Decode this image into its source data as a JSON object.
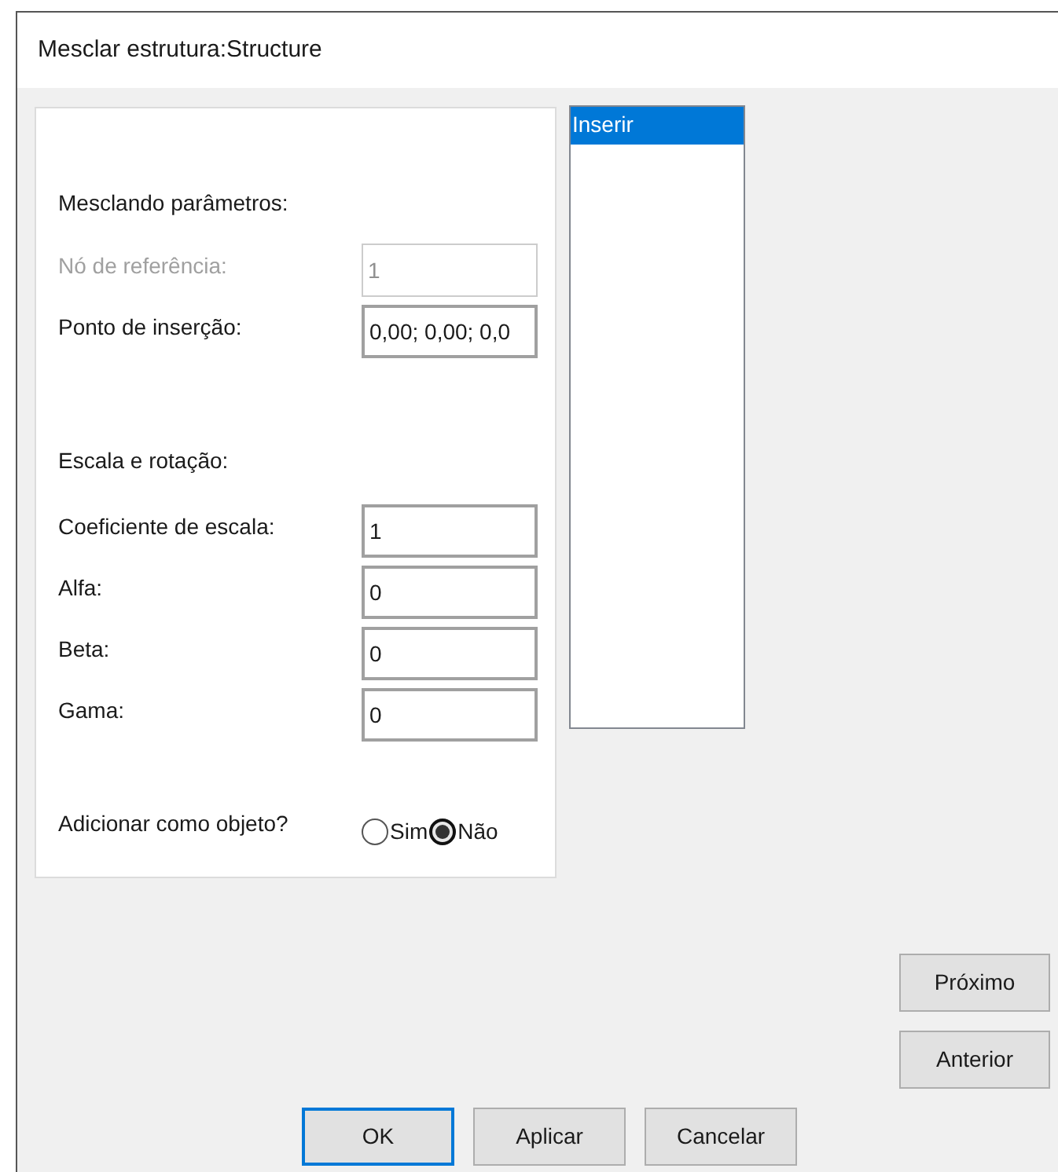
{
  "window": {
    "title": "Mesclar estrutura:Structure"
  },
  "sections": [
    {
      "heading": "Mesclando parâmetros:",
      "fields": [
        {
          "label": "Nó de referência:",
          "value": "1",
          "disabled": true
        },
        {
          "label": "Ponto de inserção:",
          "value": "0,00; 0,00; 0,0",
          "disabled": false
        }
      ]
    },
    {
      "heading": "Escala e rotação:",
      "fields": [
        {
          "label": "Coeficiente de escala:",
          "value": "1",
          "disabled": false
        },
        {
          "label": "Alfa:",
          "value": "0",
          "disabled": false
        },
        {
          "label": "Beta:",
          "value": "0",
          "disabled": false
        },
        {
          "label": "Gama:",
          "value": "0",
          "disabled": false
        }
      ]
    }
  ],
  "add_as_object": {
    "label": "Adicionar como objeto?",
    "options": [
      {
        "label": "Sim",
        "selected": false
      },
      {
        "label": "Não",
        "selected": true
      }
    ]
  },
  "list": {
    "items": [
      {
        "label": "Inserir",
        "selected": true
      }
    ]
  },
  "side_buttons": [
    "Próximo",
    "Anterior"
  ],
  "footer_buttons": [
    {
      "label": "OK",
      "default": true
    },
    {
      "label": "Aplicar",
      "default": false
    },
    {
      "label": "Cancelar",
      "default": false
    }
  ]
}
